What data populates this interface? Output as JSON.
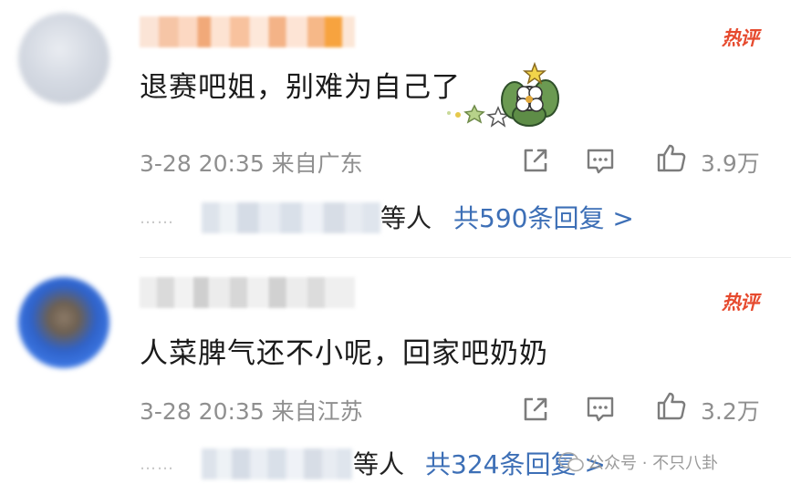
{
  "comments": [
    {
      "username": "██████████",
      "hot_badge": "热评",
      "text": "退赛吧姐，别难为自己了",
      "time_location": "3-28 20:35 来自广东",
      "likes": "3.9万",
      "replies": {
        "dots": "……",
        "repliers": "██████████",
        "and_others": "等人",
        "prefix": "共",
        "count": "590",
        "suffix": "条回复 >"
      }
    },
    {
      "username": "██████████",
      "hot_badge": "热评",
      "text": "人菜脾气还不小呢，回家吧奶奶",
      "time_location": "3-28 20:35 来自江苏",
      "likes": "3.2万",
      "replies": {
        "dots": "……",
        "repliers": "████████",
        "and_others": "等人",
        "prefix": "共",
        "count": "324",
        "suffix": "条回复 >"
      }
    }
  ],
  "watermark": "公众号 · 不只八卦",
  "colors": {
    "hot_badge": "#e64a2e",
    "link": "#3d6fb6",
    "meta": "#8f8f8f"
  }
}
